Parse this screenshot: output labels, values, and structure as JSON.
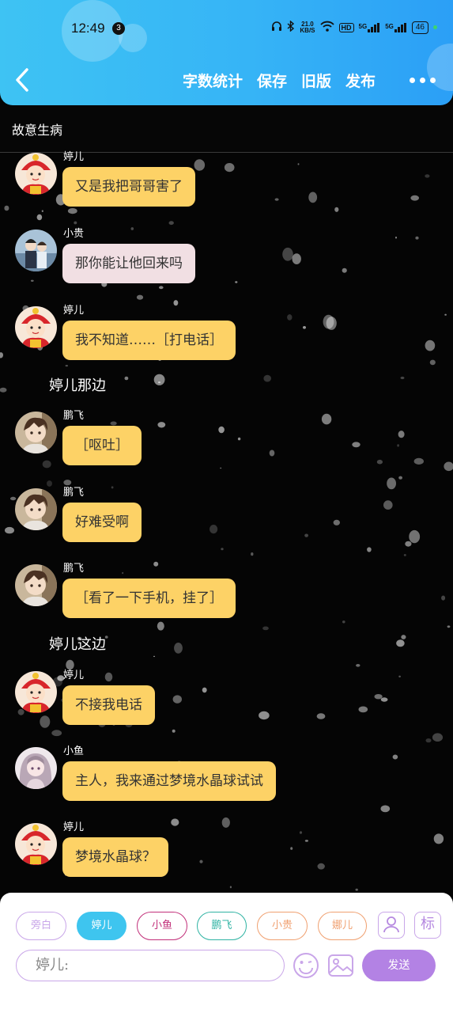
{
  "status_bar": {
    "time": "12:49",
    "notification_count": "3",
    "net_speed_top": "21.0",
    "net_speed_bottom": "KB/S",
    "hd_label": "HD",
    "sig1": "5G",
    "sig2": "5G",
    "battery": "46"
  },
  "header": {
    "actions": [
      "字数统计",
      "保存",
      "旧版",
      "发布"
    ],
    "accent": "#36b4f6"
  },
  "story_title": "故意生病",
  "messages": [
    {
      "type": "chat",
      "speaker": "婷儿",
      "text": "又是我把哥哥害了",
      "avatar": "tinger",
      "bubble": "yellow"
    },
    {
      "type": "chat",
      "speaker": "小贵",
      "text": "那你能让他回来吗",
      "avatar": "xiaogui",
      "bubble": "pink"
    },
    {
      "type": "chat",
      "speaker": "婷儿",
      "text": "我不知道……［打电话］",
      "avatar": "tinger",
      "bubble": "yellow"
    },
    {
      "type": "narration",
      "text": "婷儿那边"
    },
    {
      "type": "chat",
      "speaker": "鹏飞",
      "text": "［呕吐］",
      "avatar": "pengfei",
      "bubble": "yellow"
    },
    {
      "type": "chat",
      "speaker": "鹏飞",
      "text": "好难受啊",
      "avatar": "pengfei",
      "bubble": "yellow"
    },
    {
      "type": "chat",
      "speaker": "鹏飞",
      "text": "［看了一下手机，挂了］",
      "avatar": "pengfei",
      "bubble": "yellow"
    },
    {
      "type": "narration",
      "text": "婷儿这边"
    },
    {
      "type": "chat",
      "speaker": "婷儿",
      "text": "不接我电话",
      "avatar": "tinger",
      "bubble": "yellow"
    },
    {
      "type": "chat",
      "speaker": "小鱼",
      "text": "主人，我来通过梦境水晶球试试",
      "avatar": "xiaoyu",
      "bubble": "yellow"
    },
    {
      "type": "chat",
      "speaker": "婷儿",
      "text": "梦境水晶球？",
      "avatar": "tinger",
      "bubble": "yellow"
    }
  ],
  "composer": {
    "roles": [
      {
        "label": "旁白",
        "color": "#c9a6e9",
        "active": false
      },
      {
        "label": "婷儿",
        "color": "#3ec5ef",
        "active": true
      },
      {
        "label": "小鱼",
        "color": "#c2307a",
        "active": false
      },
      {
        "label": "鹏飞",
        "color": "#2fb3a3",
        "active": false
      },
      {
        "label": "小贵",
        "color": "#f0a070",
        "active": false
      },
      {
        "label": "娜儿",
        "color": "#f0a070",
        "active": false
      }
    ],
    "mark_label": "标",
    "input_value": "婷儿:",
    "send_label": "发送",
    "icons": [
      "character-icon",
      "mark-icon",
      "emoji-icon",
      "image-icon"
    ]
  }
}
